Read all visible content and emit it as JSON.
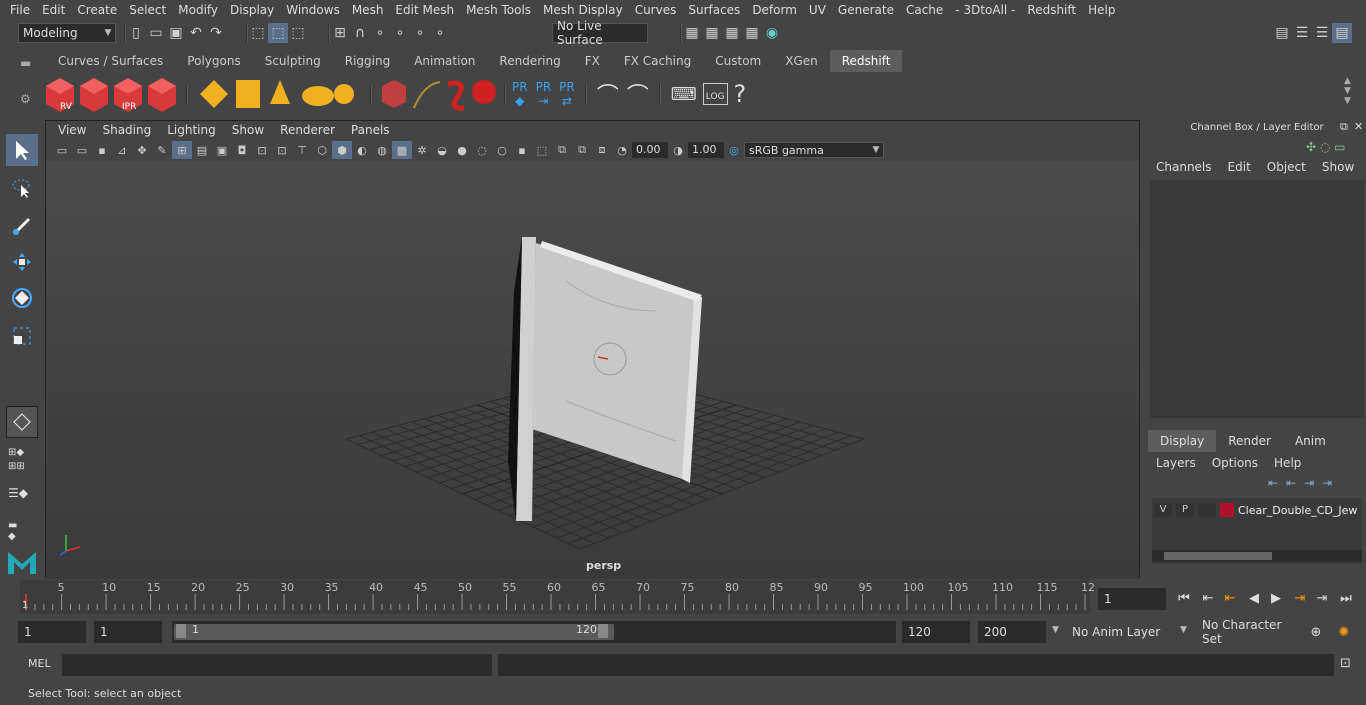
{
  "menubar": [
    "File",
    "Edit",
    "Create",
    "Select",
    "Modify",
    "Display",
    "Windows",
    "Mesh",
    "Edit Mesh",
    "Mesh Tools",
    "Mesh Display",
    "Curves",
    "Surfaces",
    "Deform",
    "UV",
    "Generate",
    "Cache",
    "- 3DtoAll -",
    "Redshift",
    "Help"
  ],
  "status": {
    "mode": "Modeling",
    "live_surface": "No Live Surface"
  },
  "shelf_tabs": [
    "Curves / Surfaces",
    "Polygons",
    "Sculpting",
    "Rigging",
    "Animation",
    "Rendering",
    "FX",
    "FX Caching",
    "Custom",
    "XGen",
    "Redshift"
  ],
  "active_shelf_tab": "Redshift",
  "shelf_labels": {
    "rv": "RV",
    "ipr": "IPR",
    "pr": "PR",
    "log": "LOG",
    "question": "?"
  },
  "viewport": {
    "menu": [
      "View",
      "Shading",
      "Lighting",
      "Show",
      "Renderer",
      "Panels"
    ],
    "exposure": "0.00",
    "gamma": "1.00",
    "colorspace": "sRGB gamma",
    "camera": "persp"
  },
  "channel_box": {
    "title": "Channel Box / Layer Editor",
    "menu": [
      "Channels",
      "Edit",
      "Object",
      "Show"
    ],
    "layer_tabs": [
      "Display",
      "Render",
      "Anim"
    ],
    "layer_menu": [
      "Layers",
      "Options",
      "Help"
    ],
    "layer": {
      "v": "V",
      "p": "P",
      "name": "Clear_Double_CD_Jew",
      "color": "#b0102a"
    }
  },
  "timeline": {
    "ticks": [
      "5",
      "10",
      "15",
      "20",
      "25",
      "30",
      "35",
      "40",
      "45",
      "50",
      "55",
      "60",
      "65",
      "70",
      "75",
      "80",
      "85",
      "90",
      "95",
      "100",
      "105",
      "110",
      "115",
      "12"
    ],
    "current_marker": "1",
    "current_frame": "1"
  },
  "range": {
    "start": "1",
    "start2": "1",
    "slider_start": "1",
    "slider_end": "120",
    "end": "120",
    "end2": "200",
    "anim_layer": "No Anim Layer",
    "character_set": "No Character Set"
  },
  "cmd": {
    "label": "MEL"
  },
  "help": "Select Tool: select an object",
  "colors": {
    "accent": "#5d5d5d",
    "bg": "#444444"
  }
}
